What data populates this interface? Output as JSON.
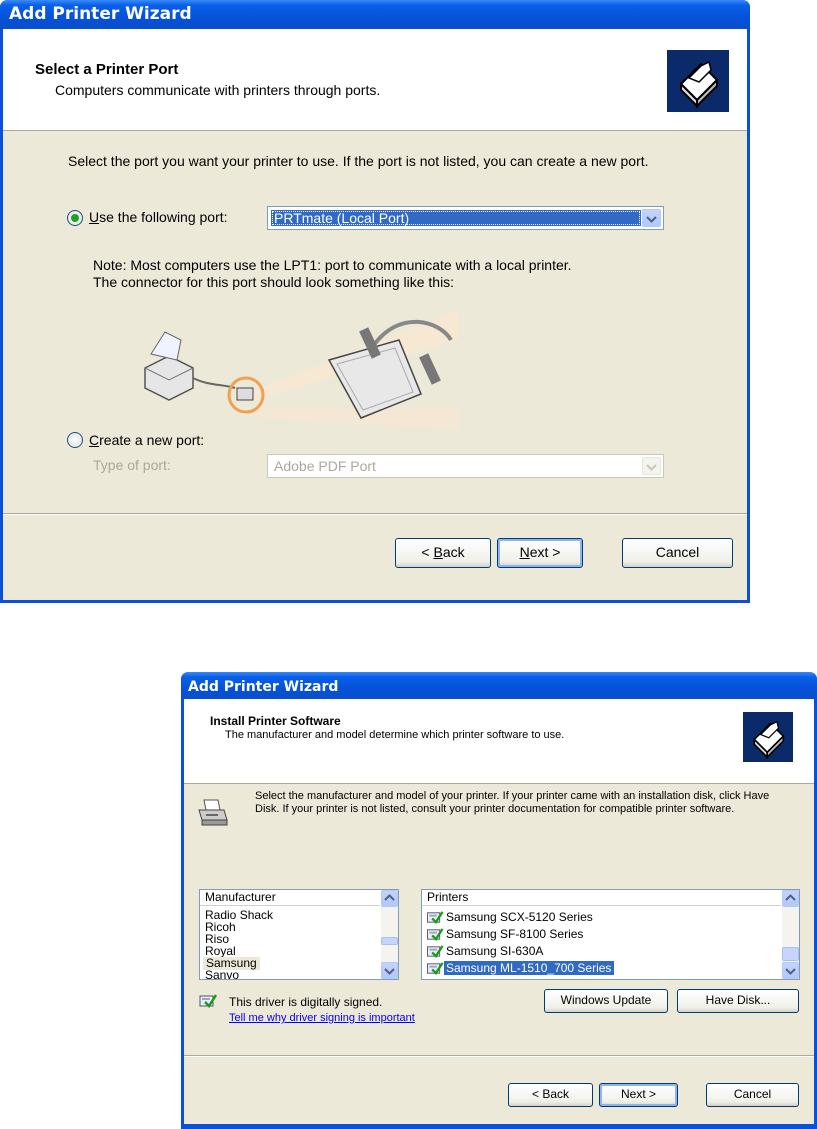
{
  "dialog1": {
    "title": "Add Printer Wizard",
    "header_title": "Select a Printer Port",
    "header_subtitle": "Computers communicate with printers through ports.",
    "instruction": "Select the port you want your printer to use.  If the port is not listed, you can create a new port.",
    "use_port": {
      "accel": "U",
      "label_rest": "se the following port:",
      "selected": true,
      "value": "PRTmate (Local Port)"
    },
    "note": "Note: Most computers use the LPT1: port to communicate with a local printer.\nThe connector for this port should look something like this:",
    "create_port": {
      "accel": "C",
      "label_rest": "reate a new port:",
      "selected": false
    },
    "type_of_port": {
      "label": "Type of port:",
      "value": "Adobe PDF Port"
    },
    "buttons": {
      "back": {
        "prefix": "< ",
        "accel": "B",
        "rest": "ack"
      },
      "next": {
        "accel": "N",
        "rest": "ext >"
      },
      "cancel": "Cancel"
    }
  },
  "dialog2": {
    "title": "Add Printer Wizard",
    "header_title": "Install Printer Software",
    "header_subtitle": "The manufacturer and model determine which printer software to use.",
    "instruction": "Select the manufacturer and model of your printer. If your printer came with an installation disk, click Have Disk. If your printer is not listed, consult your printer documentation for compatible printer software.",
    "manufacturer_header": "Manufacturer",
    "manufacturers": [
      "Radio Shack",
      "Ricoh",
      "Riso",
      "Royal",
      "Samsung",
      "Sanyo"
    ],
    "selected_manufacturer": "Samsung",
    "printers_header": "Printers",
    "printers": [
      "Samsung SCX-5120 Series",
      "Samsung SF-8100 Series",
      "Samsung SI-630A",
      "Samsung ML-1510_700 Series"
    ],
    "selected_printer": "Samsung ML-1510_700 Series",
    "signed_text": "This driver is digitally signed.",
    "signing_link": "Tell me why driver signing is important",
    "windows_update": "Windows Update",
    "have_disk": "Have Disk...",
    "buttons": {
      "back": "< Back",
      "next": "Next >",
      "cancel": "Cancel"
    }
  },
  "colors": {
    "titlebar": "#0a5fe8",
    "face": "#ece9d8",
    "selection": "#316ac5",
    "radio_dot": "#21a121",
    "link": "#0000ff"
  },
  "icons": [
    "printer-wizard-icon",
    "printer-cable-illustration",
    "printer-icon",
    "signed-driver-icon",
    "scroll-up-icon",
    "scroll-down-icon",
    "dropdown-arrow-icon"
  ]
}
